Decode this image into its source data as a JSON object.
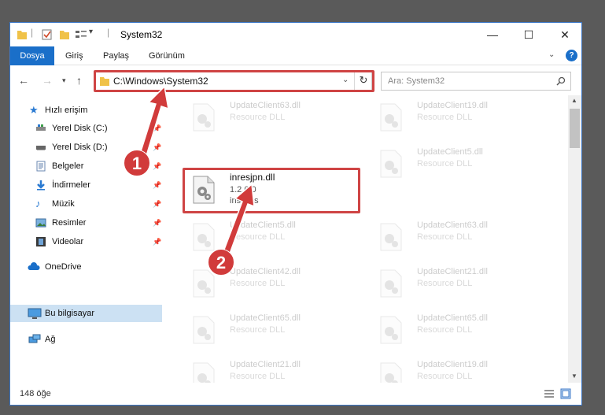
{
  "window": {
    "title": "System32",
    "minimize": "—",
    "maximize": "☐",
    "close": "✕"
  },
  "ribbon": {
    "tabs": [
      "Dosya",
      "Giriş",
      "Paylaş",
      "Görünüm"
    ],
    "help": "?"
  },
  "address": {
    "path": "C:\\Windows\\System32",
    "search_placeholder": "Ara: System32"
  },
  "sidebar": {
    "items": [
      {
        "label": "Hızlı erişim"
      },
      {
        "label": "Yerel Disk (C:)"
      },
      {
        "label": "Yerel Disk (D:)"
      },
      {
        "label": "Belgeler"
      },
      {
        "label": "İndirmeler"
      },
      {
        "label": "Müzik"
      },
      {
        "label": "Resimler"
      },
      {
        "label": "Videolar"
      },
      {
        "label": "OneDrive"
      },
      {
        "label": "Bu bilgisayar"
      },
      {
        "label": "Ağ"
      }
    ]
  },
  "files": {
    "left": [
      {
        "name": "UpdateClient63.dll",
        "desc": "Resource DLL"
      },
      {
        "name": "inresjpn.dll",
        "version": "1.2.0.0",
        "desc": "instRes"
      },
      {
        "name": "UpdateClient5.dll",
        "desc": "Resource DLL"
      },
      {
        "name": "UpdateClient42.dll",
        "desc": "Resource DLL"
      },
      {
        "name": "UpdateClient65.dll",
        "desc": "Resource DLL"
      },
      {
        "name": "UpdateClient21.dll",
        "desc": "Resource DLL"
      }
    ],
    "right": [
      {
        "name": "UpdateClient19.dll",
        "desc": "Resource DLL"
      },
      {
        "name": "UpdateClient5.dll",
        "desc": "Resource DLL"
      },
      {
        "name": "UpdateClient63.dll",
        "desc": "Resource DLL"
      },
      {
        "name": "UpdateClient21.dll",
        "desc": "Resource DLL"
      },
      {
        "name": "UpdateClient65.dll",
        "desc": "Resource DLL"
      },
      {
        "name": "UpdateClient19.dll",
        "desc": "Resource DLL"
      }
    ]
  },
  "status": {
    "count": "148 öğe"
  },
  "annotations": {
    "step1": "1",
    "step2": "2",
    "color": "#cf4444"
  }
}
